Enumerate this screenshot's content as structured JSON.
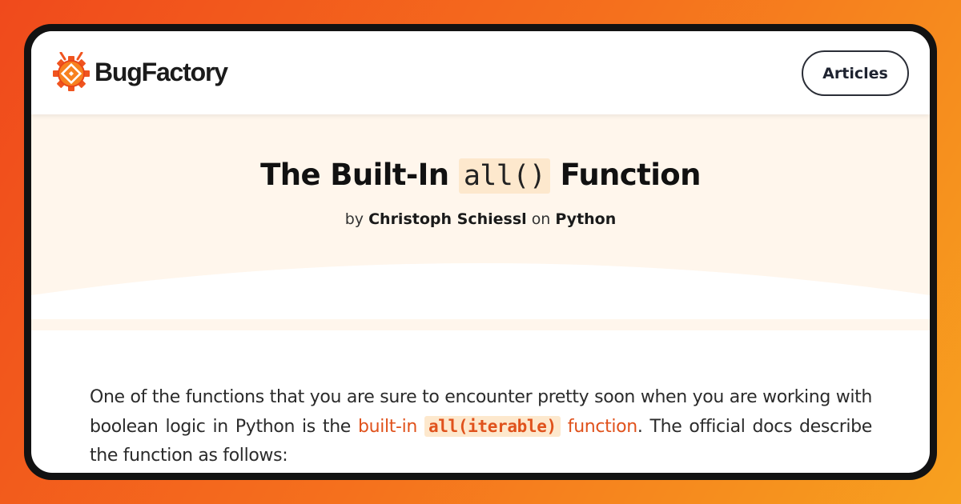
{
  "header": {
    "logo_text": "BugFactory",
    "nav_button": "Articles"
  },
  "article": {
    "title_before": "The Built-In",
    "title_code": "all()",
    "title_after": "Function",
    "byline_by": "by",
    "author": "Christoph Schiessl",
    "byline_on": "on",
    "category": "Python",
    "para_part1": "One of the functions that you are sure to encounter pretty soon when you are working with boolean logic in Python is the",
    "link_part1": "built-in",
    "link_code": "all(iterable)",
    "link_part2": "function",
    "para_part2": ". The official docs describe the function as follows:"
  },
  "colors": {
    "accent": "#e0521c",
    "hero_bg": "#fff6ec",
    "code_bg": "#fde8cd",
    "frame": "#121212"
  },
  "icons": [
    "bug-gear-logo-icon"
  ]
}
